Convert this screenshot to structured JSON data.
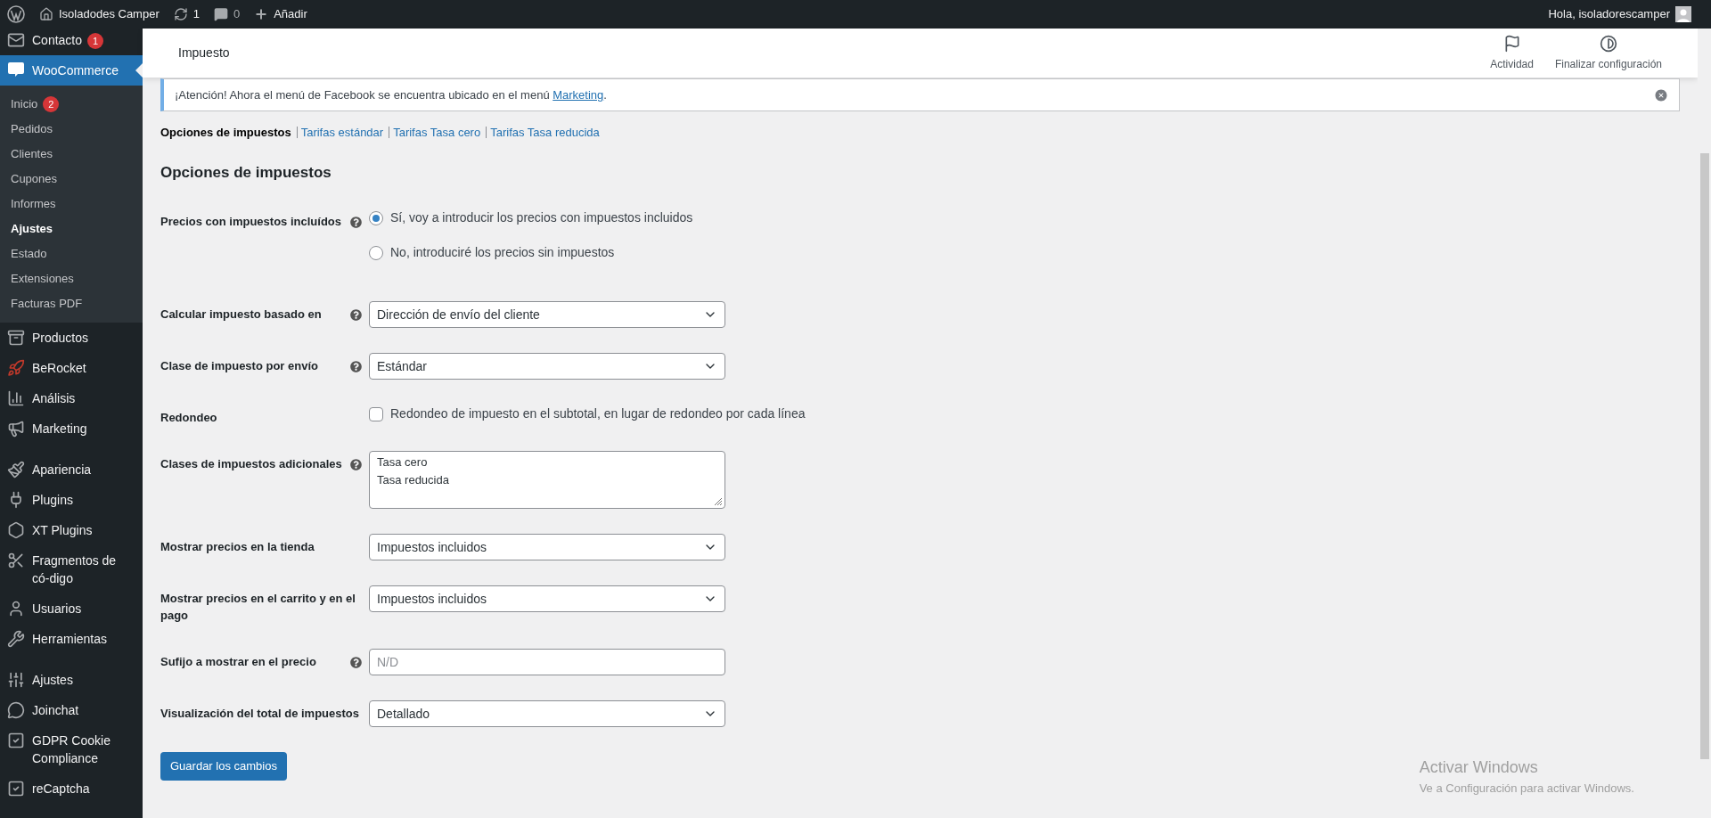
{
  "admin_bar": {
    "site": "Isoladodes Camper",
    "updates": "1",
    "comments": "0",
    "add": "Añadir",
    "greeting": "Hola, isoladorescamper"
  },
  "sidebar": {
    "items": [
      {
        "label": "Contacto",
        "badge": "1",
        "selected": false
      },
      {
        "label": "WooCommerce",
        "selected": true,
        "children": [
          {
            "label": "Inicio",
            "badge": "2",
            "selected": false
          },
          {
            "label": "Pedidos",
            "selected": false
          },
          {
            "label": "Clientes",
            "selected": false
          },
          {
            "label": "Cupones",
            "selected": false
          },
          {
            "label": "Informes",
            "selected": false
          },
          {
            "label": "Ajustes",
            "selected": true
          },
          {
            "label": "Estado",
            "selected": false
          },
          {
            "label": "Extensiones",
            "selected": false
          },
          {
            "label": "Facturas PDF",
            "selected": false
          }
        ]
      },
      {
        "label": "Productos",
        "selected": false
      },
      {
        "label": "BeRocket",
        "selected": false
      },
      {
        "label": "Análisis",
        "selected": false
      },
      {
        "label": "Marketing",
        "selected": false
      },
      {
        "label": "Apariencia",
        "selected": false
      },
      {
        "label": "Plugins",
        "selected": false
      },
      {
        "label": "XT Plugins",
        "selected": false
      },
      {
        "label": "Fragmentos de có-digo",
        "selected": false
      },
      {
        "label": "Usuarios",
        "selected": false
      },
      {
        "label": "Herramientas",
        "selected": false
      },
      {
        "label": "Ajustes",
        "selected": false
      },
      {
        "label": "Joinchat",
        "selected": false
      },
      {
        "label": "GDPR Cookie Compliance",
        "selected": false
      },
      {
        "label": "reCaptcha",
        "selected": false
      }
    ]
  },
  "header": {
    "title": "Impuesto",
    "actions": [
      "Actividad",
      "Finalizar configuración"
    ]
  },
  "notice": {
    "text": "¡Atención! Ahora el menú de Facebook se encuentra ubicado en el menú ",
    "link": "Marketing",
    "after": "."
  },
  "subnav": [
    {
      "label": "Opciones de impuestos",
      "selected": true
    },
    {
      "label": "Tarifas estándar",
      "selected": false
    },
    {
      "label": "Tarifas Tasa cero",
      "selected": false
    },
    {
      "label": "Tarifas Tasa reducida",
      "selected": false
    }
  ],
  "section_title": "Opciones de impuestos",
  "rows": [
    {
      "kind": "radio",
      "label": "Precios con impuestos incluídos",
      "help": true,
      "options": [
        {
          "label": "Sí, voy a introducir los precios con impuestos incluidos",
          "selected": true
        },
        {
          "label": "No, introduciré los precios sin impuestos",
          "selected": false
        }
      ]
    },
    {
      "kind": "select",
      "label": "Calcular impuesto basado en",
      "help": true,
      "value": "Dirección de envío del cliente"
    },
    {
      "kind": "select",
      "label": "Clase de impuesto por envío",
      "help": true,
      "value": "Estándar"
    },
    {
      "kind": "checkbox",
      "label": "Redondeo",
      "help": false,
      "checked": false,
      "text": "Redondeo de impuesto en el subtotal, en lugar de redondeo por cada línea"
    },
    {
      "kind": "textarea",
      "label": "Clases de impuestos adicionales",
      "help": true,
      "lines": [
        "Tasa cero",
        "Tasa reducida"
      ]
    },
    {
      "kind": "select",
      "label": "Mostrar precios en la tienda",
      "help": false,
      "value": "Impuestos incluidos"
    },
    {
      "kind": "select",
      "label": "Mostrar precios en el carrito y en el pago",
      "help": false,
      "value": "Impuestos incluidos"
    },
    {
      "kind": "text",
      "label": "Sufijo a mostrar en el precio",
      "help": true,
      "placeholder": "N/D"
    },
    {
      "kind": "select",
      "label": "Visualización del total de impuestos",
      "help": false,
      "value": "Detallado"
    }
  ],
  "save_button": "Guardar los cambios",
  "os_overlay": {
    "title": "Activar Windows",
    "text": "Ve a Configuración para activar Windows."
  }
}
